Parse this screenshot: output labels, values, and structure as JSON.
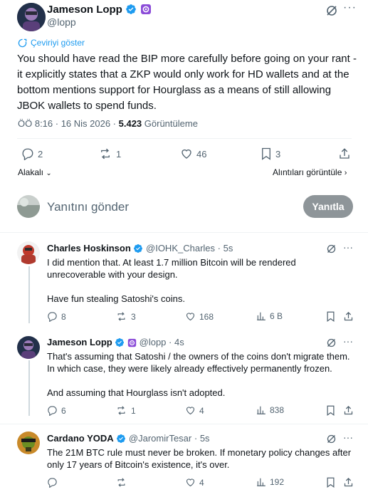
{
  "main_post": {
    "author_name": "Jameson Lopp",
    "author_handle": "@lopp",
    "translate_label": "Çeviriyi göster",
    "text": "You should have read the BIP more carefully before going on your rant - it explicitly states that a ZKP would only work for HD wallets and at the bottom mentions support for Hourglass as a means of still allowing JBOK wallets to spend funds.",
    "time": "ÖÖ 8:16 · 16 Nis 2026 · ",
    "views_count": "5.423",
    "views_label": " Görüntüleme",
    "replies": "2",
    "reposts": "1",
    "likes": "46",
    "bookmarks": "3",
    "relevant_label": "Alakalı",
    "quotes_label": "Alıntıları görüntüle"
  },
  "composer": {
    "placeholder": "Yanıtını gönder",
    "button_label": "Yanıtla"
  },
  "replies": [
    {
      "author_name": "Charles Hoskinson",
      "author_handle": "@IOHK_Charles",
      "time": "· 5s",
      "text_lines": [
        "I did mention that. At least 1.7 million Bitcoin will be rendered",
        "unrecoverable with your design."
      ],
      "text2": "Have fun stealing Satoshi's coins.",
      "replies": "8",
      "reposts": "3",
      "likes": "168",
      "views": "6 B"
    },
    {
      "author_name": "Jameson Lopp",
      "author_handle": "@lopp",
      "time": "· 4s",
      "text_lines": [
        "That's assuming that Satoshi / the owners of the coins don't migrate them.",
        "In which case, they were likely already effectively permanently frozen."
      ],
      "text2": "And assuming that Hourglass isn't adopted.",
      "replies": "6",
      "reposts": "1",
      "likes": "4",
      "views": "838"
    },
    {
      "author_name": "Cardano YODA",
      "author_handle": "@JaromirTesar",
      "time": "· 5s",
      "text_lines": [
        "The 21M BTC rule must never be broken. If monetary policy changes after",
        "only 17 years of Bitcoin's existence, it's over."
      ],
      "replies": "",
      "reposts": "",
      "likes": "4",
      "views": "192"
    }
  ],
  "colors": {
    "verified": "#1d9bf0",
    "accent": "#1d9bf0",
    "muted": "#536471",
    "reply_button": "#8e9599"
  }
}
